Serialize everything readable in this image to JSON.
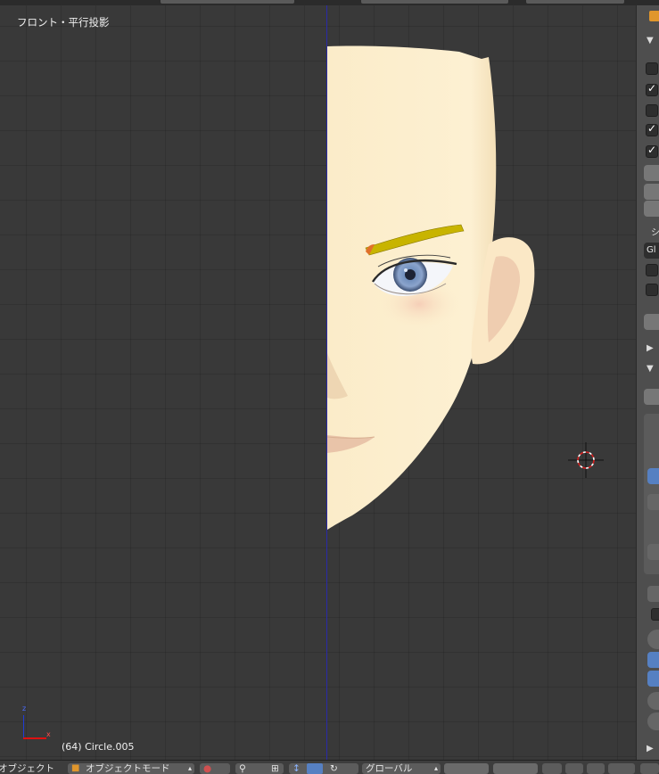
{
  "viewport": {
    "view_label": "フロント・平行投影",
    "object_info": "(64) Circle.005",
    "axis_z_label": "z",
    "axis_x_label": "x"
  },
  "sidebar": {
    "label_1": "シ",
    "label_2": "Gl"
  },
  "header_bar": {
    "editor_label": "オブジェクト",
    "mode_label": "オブジェクトモード",
    "orientation_label": "グローバル"
  },
  "colors": {
    "background": "#393939",
    "symmetry_line": "#2a2aa8",
    "skin": "#fceccb",
    "eyebrow": "#c8b400",
    "iris": "#7890b8"
  }
}
